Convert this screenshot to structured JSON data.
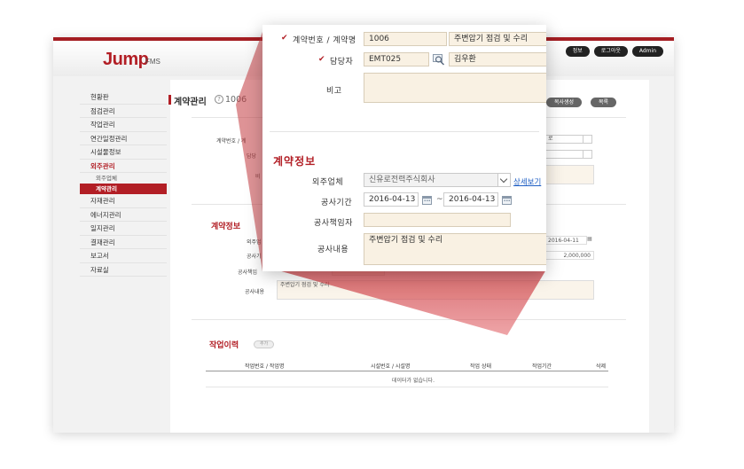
{
  "app": {
    "logo": "Jump",
    "logo_sub": "FMS",
    "top_buttons": [
      "정보",
      "로그아웃",
      "Admin"
    ],
    "page_title": "계약관리",
    "page_title_num": "1006",
    "action_buttons": [
      "목사생성",
      "목록"
    ]
  },
  "sidebar": {
    "items": [
      {
        "label": "현황판"
      },
      {
        "label": "점검관리"
      },
      {
        "label": "작업관리"
      },
      {
        "label": "연간일정관리"
      },
      {
        "label": "시설물정보"
      },
      {
        "label": "외주관리"
      },
      {
        "label": "자재관리"
      },
      {
        "label": "에너지관리"
      },
      {
        "label": "일지관리"
      },
      {
        "label": "결재관리"
      },
      {
        "label": "보고서"
      },
      {
        "label": "자료실"
      }
    ],
    "sub_items": [
      "외주업체",
      "계약관리"
    ]
  },
  "background_form": {
    "contract_label": "계약번호 / 계",
    "manager_label": "담당",
    "note_label": "비",
    "select_value": "로",
    "section_title": "계약정보",
    "vendor_label": "외주업",
    "period_label": "공사기",
    "responsible_label": "공사책임",
    "content_label": "공사내용",
    "content_value": "주변압기 점검 및 수리",
    "end_date": "2016-04-11",
    "amount": "2,000,000"
  },
  "history": {
    "title": "작업이력",
    "add_button": "추가",
    "columns": [
      "작업번호 / 작업명",
      "시설번호 / 시설명",
      "작업 상태",
      "작업기간",
      "삭제"
    ],
    "empty_text": "데이터가 없습니다."
  },
  "zoom": {
    "contract_label": "계약번호 / 계약명",
    "contract_no": "1006",
    "contract_name": "주변압기 점검 및 수리",
    "manager_label": "담당자",
    "manager_id": "EMT025",
    "manager_name": "김우환",
    "note_label": "비고",
    "section_title": "계약정보",
    "vendor_label": "외주업체",
    "vendor_value": "신유로전력주식회사",
    "detail_link": "상세보기",
    "period_label": "공사기간",
    "start_date": "2016-04-13",
    "end_date": "2016-04-13",
    "tilde": "~",
    "responsible_label": "공사책임자",
    "content_label": "공사내용",
    "content_value": "주변압기 점검 및 수리"
  },
  "colors": {
    "brand_red": "#b21e25",
    "field_bg": "#f9f1e3",
    "link_blue": "#1f5fc4"
  }
}
